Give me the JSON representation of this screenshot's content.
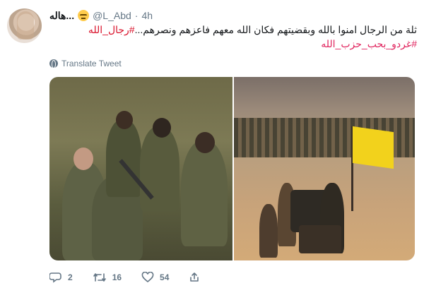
{
  "tweet": {
    "display_name": "هاله...",
    "handle": "@L_Abd",
    "separator": "·",
    "time": "4h",
    "text_line1": "ثلة من الرجال امنوا بالله وبقضيتهم فكان الله معهم فاعزهم ونصرهم...",
    "hashtag1": "#رجال_الله",
    "hashtag2": "#غردو_بحب_حزب_الله",
    "translate_label": "Translate Tweet"
  },
  "actions": {
    "reply_count": "2",
    "retweet_count": "16",
    "like_count": "54"
  },
  "colors": {
    "hashtag": "#e0245e",
    "muted": "#657786"
  }
}
